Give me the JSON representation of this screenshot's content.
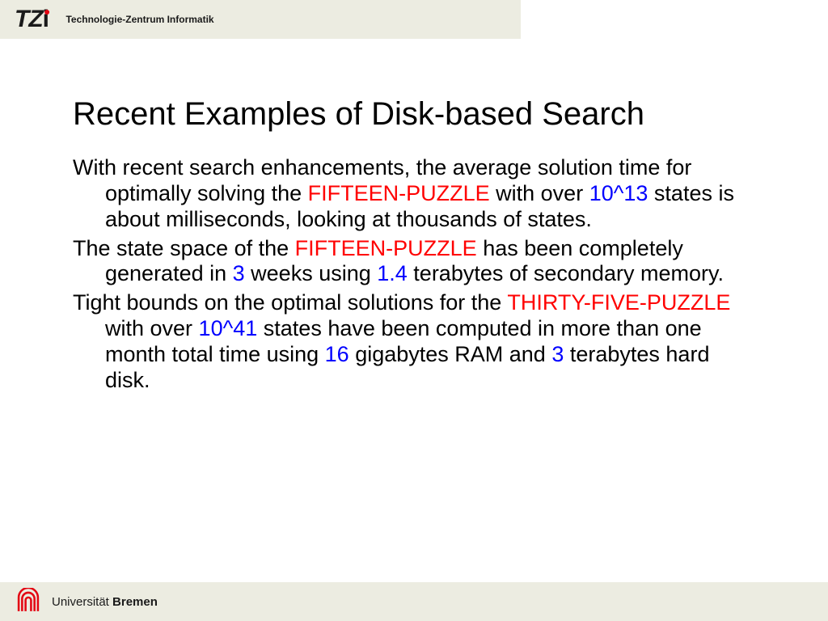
{
  "header": {
    "logo_mark": "TZi",
    "logo_sub": "Technologie-Zentrum Informatik"
  },
  "slide": {
    "title": "Recent Examples of Disk-based Search",
    "p1": {
      "t1": "With recent search enhancements, the average solution time for optimally solving the ",
      "r1": "FIFTEEN-PUZZLE",
      "t2": " with over ",
      "b1": "10^13",
      "t3": " states is about milliseconds, looking at thousands of states."
    },
    "p2": {
      "t1": "The state space of the ",
      "r1": "FIFTEEN-PUZZLE",
      "t2": " has been completely generated in ",
      "b1": "3",
      "t3": " weeks using ",
      "b2": "1.4",
      "t4": " terabytes of secondary memory."
    },
    "p3": {
      "t1": "Tight bounds on the optimal solutions for the ",
      "r1": "THIRTY-FIVE-PUZZLE",
      "t2": " with over ",
      "b1": "10^41",
      "t3": " states have been computed in more than one month total time using ",
      "b2": "16",
      "t4": " gigabytes RAM and ",
      "b3": "3",
      "t5": " terabytes hard disk."
    }
  },
  "footer": {
    "uni": "Universität ",
    "bremen": "Bremen"
  }
}
